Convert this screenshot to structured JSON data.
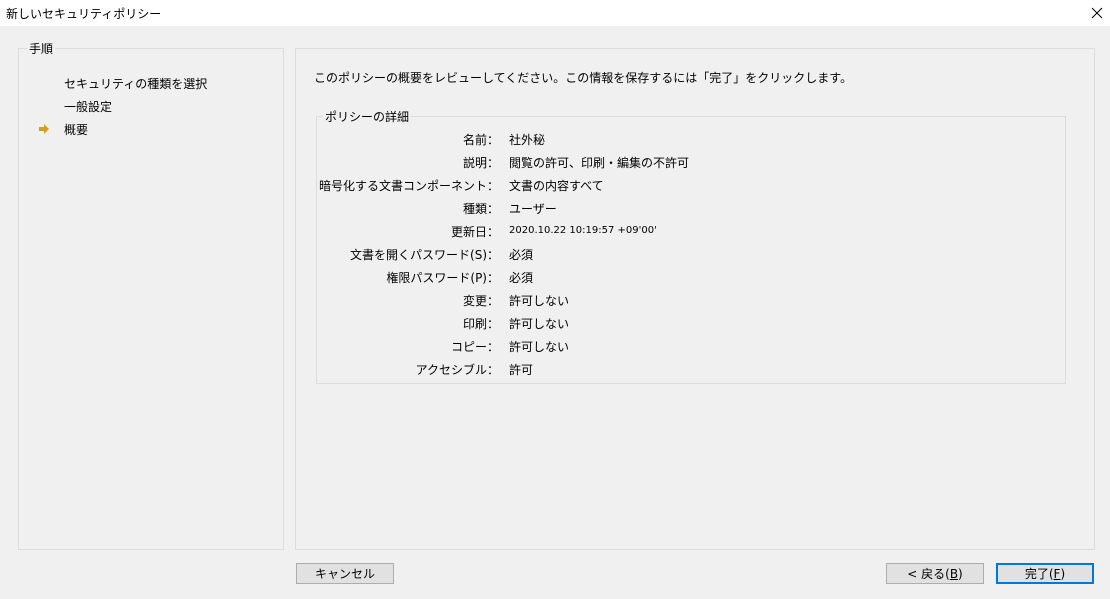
{
  "window": {
    "title": "新しいセキュリティポリシー"
  },
  "steps": {
    "legend": "手順",
    "items": [
      {
        "label": "セキュリティの種類を選択",
        "current": false
      },
      {
        "label": "一般設定",
        "current": false
      },
      {
        "label": "概要",
        "current": true
      }
    ]
  },
  "main": {
    "instruction": "このポリシーの概要をレビューしてください。この情報を保存するには「完了」をクリックします。",
    "details": {
      "legend": "ポリシーの詳細",
      "rows": [
        {
          "label": "名前：",
          "value": "社外秘"
        },
        {
          "label": "説明：",
          "value": "閲覧の許可、印刷・編集の不許可"
        },
        {
          "label": "暗号化する文書コンポーネント：",
          "value": "文書の内容すべて"
        },
        {
          "label": "種類：",
          "value": "ユーザー"
        },
        {
          "label": "更新日：",
          "value": "2020.10.22 10:19:57 +09'00'"
        },
        {
          "label": "文書を開くパスワード(S)：",
          "value": "必須"
        },
        {
          "label": "権限パスワード(P)：",
          "value": "必須"
        },
        {
          "label": "変更：",
          "value": "許可しない"
        },
        {
          "label": "印刷：",
          "value": "許可しない"
        },
        {
          "label": "コピー：",
          "value": "許可しない"
        },
        {
          "label": "アクセシブル：",
          "value": "許可"
        }
      ]
    }
  },
  "buttons": {
    "cancel": "キャンセル",
    "back_prefix": "< 戻る(",
    "back_key": "B",
    "back_suffix": ")",
    "finish_prefix": "完了(",
    "finish_key": "F",
    "finish_suffix": ")"
  },
  "colors": {
    "step_arrow": "#d4a017",
    "primary_border": "#0078d7"
  },
  "icons": {
    "close": "close-icon",
    "step_arrow": "arrow-right-icon"
  }
}
